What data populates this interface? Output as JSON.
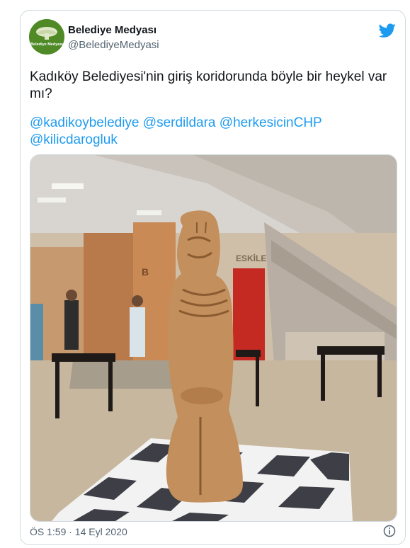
{
  "tweet": {
    "author_name": "Belediye Medyası",
    "author_handle": "@BelediyeMedyasi",
    "avatar_text": "Belediye Medyası",
    "text": "Kadıköy Belediyesi'nin giriş koridorunda böyle bir heykel var mı?",
    "mentions": [
      "@kadikoybelediye",
      "@serdildara",
      "@herkesicinCHP",
      "@kilicdarogluk"
    ],
    "timestamp": "ÖS 1:59 · 14 Eyl 2020",
    "photo": {
      "sign_letter": "B",
      "sign_text": "ESKİLER"
    }
  },
  "icons": {
    "platform": "twitter-bird-icon",
    "info": "info-icon"
  },
  "colors": {
    "accent": "#1d9bf0",
    "text": "#0f1419",
    "muted": "#536471",
    "border": "#cfd9de",
    "avatar_bg": "#4f8a26"
  }
}
